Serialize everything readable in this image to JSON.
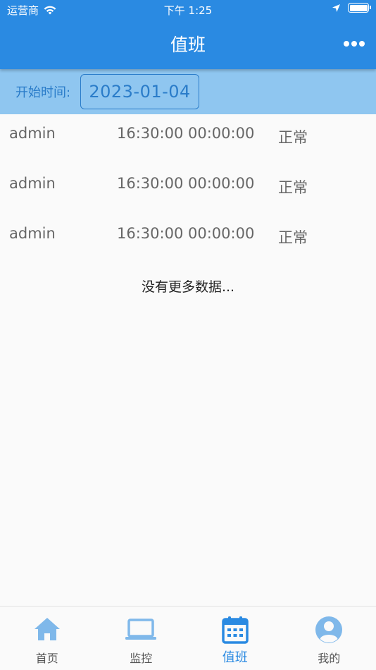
{
  "status_bar": {
    "carrier": "运营商",
    "time": "下午 1:25"
  },
  "header": {
    "title": "值班"
  },
  "filter": {
    "label": "开始时间:",
    "date": "2023-01-04"
  },
  "duty_list": [
    {
      "name": "admin",
      "time": "16:30:00 00:00:00",
      "status": "正常"
    },
    {
      "name": "admin",
      "time": "16:30:00 00:00:00",
      "status": "正常"
    },
    {
      "name": "admin",
      "time": "16:30:00 00:00:00",
      "status": "正常"
    }
  ],
  "list_footer": "没有更多数据...",
  "tabbar": {
    "tabs": [
      {
        "label": "首页",
        "icon": "home-icon"
      },
      {
        "label": "监控",
        "icon": "laptop-icon"
      },
      {
        "label": "值班",
        "icon": "calendar-icon",
        "active": true
      },
      {
        "label": "我的",
        "icon": "user-icon"
      }
    ]
  },
  "colors": {
    "primary": "#2a8ae2",
    "filter_bar": "#8fc6f0",
    "tab_inactive": "#7fb8ea"
  }
}
